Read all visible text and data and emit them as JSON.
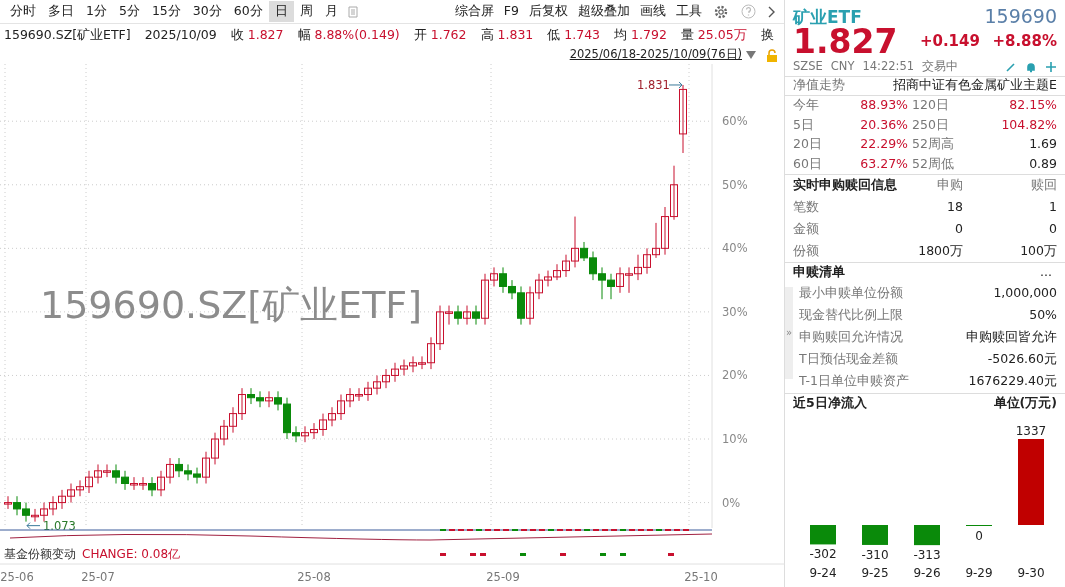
{
  "toolbar": {
    "periods": [
      {
        "label": "分时",
        "selected": false
      },
      {
        "label": "多日",
        "selected": false
      },
      {
        "label": "1分",
        "selected": false
      },
      {
        "label": "5分",
        "selected": false
      },
      {
        "label": "15分",
        "selected": false
      },
      {
        "label": "30分",
        "selected": false
      },
      {
        "label": "60分",
        "selected": false
      },
      {
        "label": "日",
        "selected": true
      },
      {
        "label": "周",
        "selected": false
      },
      {
        "label": "月",
        "selected": false
      }
    ],
    "tools": [
      "综合屏",
      "F9",
      "后复权",
      "超级叠加",
      "画线",
      "工具"
    ]
  },
  "quote_line": [
    {
      "label": "159690.SZ[矿业ETF]"
    },
    {
      "label": "2025/10/09"
    },
    {
      "label": "收",
      "value": "1.827"
    },
    {
      "label": "幅",
      "value": "8.88%(0.149)"
    },
    {
      "label": "开",
      "value": "1.762"
    },
    {
      "label": "高",
      "value": "1.831"
    },
    {
      "label": "低",
      "value": "1.743"
    },
    {
      "label": "均",
      "value": "1.792"
    },
    {
      "label": "量",
      "value": "25.05万"
    },
    {
      "label": "换"
    }
  ],
  "date_range": "2025/06/18-2025/10/09(76日)",
  "chart": {
    "watermark": "159690.SZ[矿业ETF]",
    "high_label": "1.831",
    "low_label": "1.073",
    "chart_data": {
      "type": "candlestick",
      "categories": [
        null,
        "25-06",
        null,
        null,
        null,
        null,
        null,
        null,
        null,
        null,
        "25-07",
        null,
        null,
        null,
        null,
        null,
        null,
        null,
        null,
        null,
        null,
        null,
        null,
        null,
        null,
        null,
        null,
        null,
        null,
        null,
        null,
        null,
        null,
        null,
        "25-08",
        null,
        null,
        null,
        null,
        null,
        null,
        null,
        null,
        null,
        null,
        null,
        null,
        null,
        null,
        null,
        null,
        null,
        null,
        null,
        null,
        "25-09",
        null,
        null,
        null,
        null,
        null,
        null,
        null,
        null,
        null,
        null,
        null,
        null,
        null,
        null,
        null,
        null,
        null,
        null,
        null,
        null,
        null,
        "25-10"
      ],
      "ohlc": [
        [
          0,
          1,
          -1,
          0
        ],
        [
          0,
          1,
          -2,
          -1
        ],
        [
          -1,
          0,
          -3,
          -2
        ],
        [
          -2,
          -1,
          -3,
          -2
        ],
        [
          -2,
          0,
          -3,
          -1
        ],
        [
          -1,
          1,
          -2,
          0
        ],
        [
          0,
          2,
          -1,
          1
        ],
        [
          1,
          3,
          0,
          2
        ],
        [
          2,
          3.5,
          1,
          2.5
        ],
        [
          2.5,
          5,
          1.5,
          4
        ],
        [
          4,
          6,
          3,
          5
        ],
        [
          5,
          6,
          4,
          5
        ],
        [
          5,
          6,
          3,
          4
        ],
        [
          4,
          5,
          2,
          3
        ],
        [
          3,
          4,
          2,
          3
        ],
        [
          3,
          4,
          2,
          3
        ],
        [
          3,
          4,
          1,
          2
        ],
        [
          2,
          5,
          1,
          4
        ],
        [
          4,
          7,
          3,
          6
        ],
        [
          6,
          7,
          4,
          5
        ],
        [
          5,
          6,
          3.5,
          4.5
        ],
        [
          4.5,
          5.5,
          3,
          4
        ],
        [
          4,
          8,
          3,
          7
        ],
        [
          7,
          11,
          6,
          10
        ],
        [
          10,
          13,
          9,
          12
        ],
        [
          12,
          15,
          11,
          14
        ],
        [
          14,
          18,
          13,
          17
        ],
        [
          17,
          18,
          15.5,
          16.5
        ],
        [
          16.5,
          17.5,
          15,
          16
        ],
        [
          16,
          17.5,
          15,
          16.5
        ],
        [
          16.5,
          17.5,
          14.5,
          15.5
        ],
        [
          15.5,
          16.5,
          10,
          11
        ],
        [
          11,
          12,
          9.5,
          10.5
        ],
        [
          10.5,
          12,
          9.5,
          11
        ],
        [
          11,
          12.5,
          10,
          11.5
        ],
        [
          11.5,
          14,
          10.5,
          13
        ],
        [
          13,
          15,
          12,
          14
        ],
        [
          14,
          17,
          13,
          16
        ],
        [
          16,
          18,
          15,
          17
        ],
        [
          17,
          18,
          16,
          17
        ],
        [
          17,
          19,
          16,
          18
        ],
        [
          18,
          20,
          17,
          19
        ],
        [
          19,
          21,
          18,
          20
        ],
        [
          20,
          22,
          19,
          21
        ],
        [
          21,
          22.5,
          20,
          21.5
        ],
        [
          21.5,
          23,
          20.5,
          22
        ],
        [
          22,
          23,
          21,
          22
        ],
        [
          22,
          26,
          21,
          25
        ],
        [
          25,
          31,
          24,
          30
        ],
        [
          30,
          31,
          28,
          30
        ],
        [
          30,
          31,
          28,
          29
        ],
        [
          29,
          31,
          28,
          30
        ],
        [
          30,
          31,
          28,
          29
        ],
        [
          29,
          36,
          28,
          35
        ],
        [
          35,
          37,
          34,
          36
        ],
        [
          36,
          37,
          33,
          34
        ],
        [
          34,
          35,
          32,
          33
        ],
        [
          33,
          34,
          28,
          29
        ],
        [
          29,
          34,
          28,
          33
        ],
        [
          33,
          36,
          32,
          35
        ],
        [
          35,
          36.5,
          34,
          35.5
        ],
        [
          35.5,
          37.5,
          35,
          36.5
        ],
        [
          36.5,
          39,
          35.5,
          38
        ],
        [
          38,
          45,
          37,
          40
        ],
        [
          40,
          41,
          38,
          38.5
        ],
        [
          38.5,
          39.5,
          35,
          36
        ],
        [
          36,
          37,
          32,
          35
        ],
        [
          35,
          36,
          32,
          34
        ],
        [
          34,
          37,
          33,
          36
        ],
        [
          36,
          37,
          33,
          36
        ],
        [
          36,
          39,
          35,
          37
        ],
        [
          37,
          40,
          36,
          39
        ],
        [
          39,
          44,
          38.5,
          40
        ],
        [
          40,
          46.5,
          39,
          45
        ],
        [
          45,
          53,
          44.5,
          50
        ],
        [
          58,
          65.7,
          55,
          65
        ],
        null,
        null
      ],
      "ylim": [
        -4,
        69
      ],
      "grid": true,
      "yticks": [
        {
          "value": 0,
          "label": "0%"
        },
        {
          "value": 10,
          "label": "10%"
        },
        {
          "value": 20,
          "label": "20%"
        },
        {
          "value": 30,
          "label": "30%"
        },
        {
          "value": 40,
          "label": "40%"
        },
        {
          "value": 50,
          "label": "50%"
        },
        {
          "value": 60,
          "label": "60%"
        }
      ]
    }
  },
  "indicator": {
    "name": "基金份额变动",
    "reading": "CHANGE: 0.08亿"
  },
  "quote": {
    "name": "矿业ETF",
    "code": "159690",
    "price": "1.827",
    "change": "+0.149",
    "change_pct": "+8.88%",
    "exchange": "SZSE",
    "currency": "CNY",
    "time": "14:22:51",
    "status": "交易中"
  },
  "nav_trend": {
    "label": "净值走势",
    "index_name": "招商中证有色金属矿业主题E"
  },
  "returns": [
    {
      "label": "今年",
      "value": "88.93%",
      "label2": "120日",
      "value2": "82.15%"
    },
    {
      "label": "5日",
      "value": "20.36%",
      "label2": "250日",
      "value2": "104.82%"
    },
    {
      "label": "20日",
      "value": "22.29%",
      "label2": "52周高",
      "value2": "1.69"
    },
    {
      "label": "60日",
      "value": "63.27%",
      "label2": "52周低",
      "value2": "0.89"
    }
  ],
  "subscription": {
    "title": "实时申购赎回信息",
    "col1": "申购",
    "col2": "赎回",
    "rows": [
      {
        "label": "笔数",
        "v1": "18",
        "v2": "1"
      },
      {
        "label": "金额",
        "v1": "0",
        "v2": "0"
      },
      {
        "label": "份额",
        "v1": "1800万",
        "v2": "100万"
      }
    ]
  },
  "creation_list": {
    "title": "申赎清单",
    "more": "...",
    "rows": [
      {
        "label": "最小申赎单位份额",
        "value": "1,000,000"
      },
      {
        "label": "现金替代比例上限",
        "value": "50%"
      },
      {
        "label": "申购赎回允许情况",
        "value": "申购赎回皆允许"
      },
      {
        "label": "T日预估现金差额",
        "value": "-5026.60元"
      },
      {
        "label": "T-1日单位申赎资产",
        "value": "1676229.40元"
      }
    ]
  },
  "collapse_handle": "»",
  "net_inflow": {
    "title": "近5日净流入",
    "unit": "单位(万元)",
    "chart_data": {
      "type": "bar",
      "categories": [
        "9-24",
        "9-25",
        "9-26",
        "9-29",
        "9-30"
      ],
      "values": [
        -302,
        -310,
        -313,
        0,
        1337
      ],
      "data_labels": true
    }
  }
}
